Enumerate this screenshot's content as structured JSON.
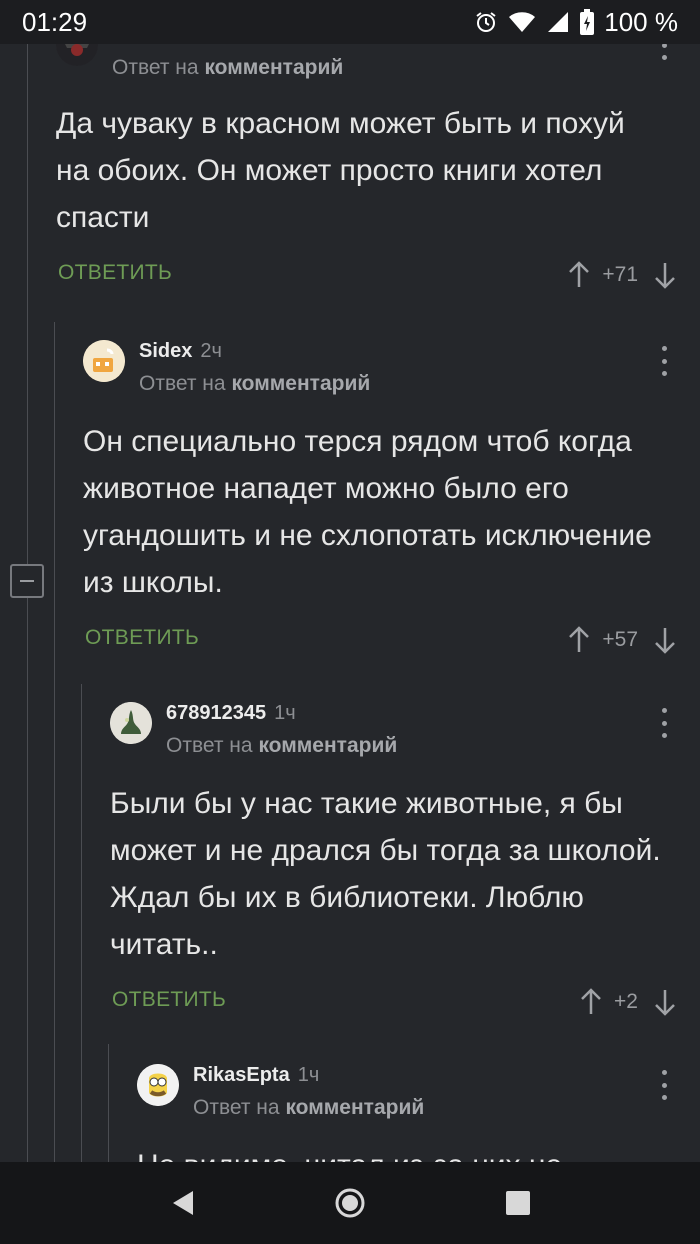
{
  "status_bar": {
    "time": "01:29",
    "battery": "100 %"
  },
  "reply_label": "Ответ на",
  "reply_target": "комментарий",
  "reply_action": "ОТВЕТИТЬ",
  "comments": [
    {
      "author": "",
      "time": "",
      "text": "Да чуваку в красном может быть и похуй на обоих. Он может просто книги хотел спасти",
      "score": "+71"
    },
    {
      "author": "Sidex",
      "time": "2ч",
      "text": "Он специально терся рядом чтоб когда животное нападет можно было его угандошить и не схлопотать исключение из школы.",
      "score": "+57"
    },
    {
      "author": "678912345",
      "time": "1ч",
      "text": "Были бы у нас такие животные, я бы может и не дрался бы тогда за школой. Ждал бы их в библиотеки. Люблю читать..",
      "score": "+2"
    },
    {
      "author": "RikasEpta",
      "time": "1ч",
      "text": "Но видимо, читал из-за них не",
      "score": ""
    }
  ],
  "icons": {
    "alarm": "alarm-icon",
    "wifi": "wifi-icon",
    "signal": "signal-icon",
    "battery": "battery-icon",
    "kebab": "more-options-icon",
    "up": "arrow-up-icon",
    "down": "arrow-down-icon",
    "back": "back-icon",
    "home": "home-icon",
    "recents": "recents-icon"
  },
  "colors": {
    "background": "#25272b",
    "accent_green": "#6e9c55",
    "muted": "#8d8f93"
  }
}
